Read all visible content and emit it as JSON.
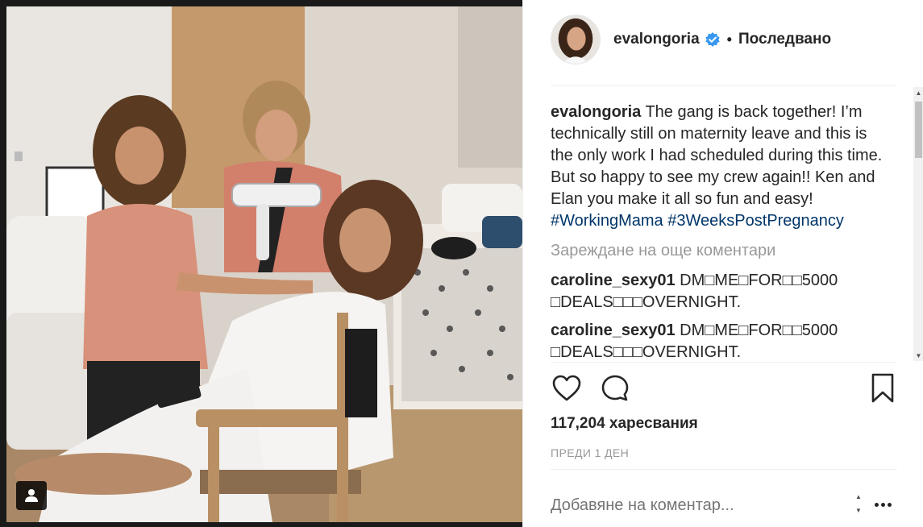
{
  "post": {
    "username": "evalongoria",
    "follow_status": "Последвано",
    "dot": "•",
    "caption": {
      "username": "evalongoria",
      "text": " The gang is back together! I’m technically still on maternity leave and this is the only work I had scheduled during this time. But so happy to see my crew again!! Ken and Elan you make it all so fun and easy! ",
      "hashtags": [
        "#WorkingMama",
        "#3WeeksPostPregnancy"
      ]
    },
    "load_more": "Зареждане на още коментари",
    "comments": [
      {
        "username": "caroline_sexy01",
        "text": " DM□ME□FOR□□5000 □DEALS□□□OVERNIGHT."
      },
      {
        "username": "caroline_sexy01",
        "text": " DM□ME□FOR□□5000 □DEALS□□□OVERNIGHT."
      }
    ],
    "likes": "117,204 харесвания",
    "time_ago": "ПРЕДИ 1 ДЕН",
    "add_comment_placeholder": "Добавяне на коментар..."
  },
  "icons": {
    "verified": "verified-badge-icon",
    "like": "heart-icon",
    "comment": "comment-bubble-icon",
    "save": "bookmark-icon",
    "more": "more-options-icon",
    "user_tag": "user-tag-icon"
  },
  "colors": {
    "text": "#262626",
    "muted": "#999999",
    "hashtag": "#003569",
    "verified": "#3897f0",
    "divider": "#efefef"
  }
}
